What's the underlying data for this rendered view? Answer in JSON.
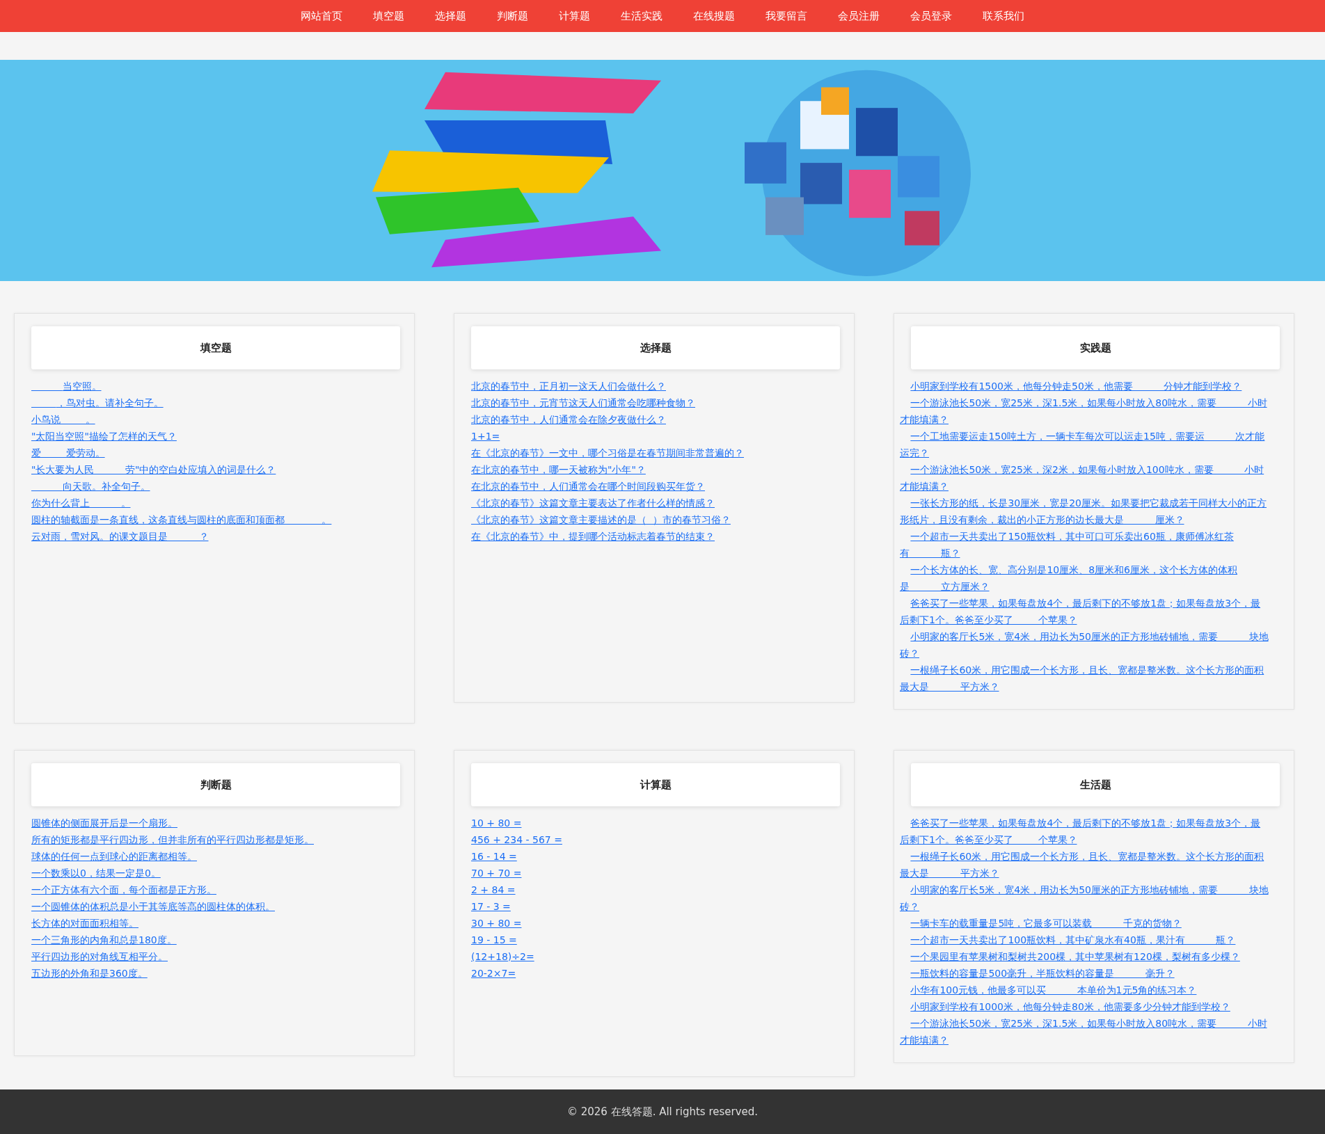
{
  "nav": [
    {
      "label": "网站首页"
    },
    {
      "label": "填空题"
    },
    {
      "label": "选择题"
    },
    {
      "label": "判断题"
    },
    {
      "label": "计算题"
    },
    {
      "label": "生活实践"
    },
    {
      "label": "在线搜题"
    },
    {
      "label": "我要留言"
    },
    {
      "label": "会员注册"
    },
    {
      "label": "会员登录"
    },
    {
      "label": "联系我们"
    }
  ],
  "cards": [
    {
      "title": "填空题",
      "indent": false,
      "items": [
        "          当空照。",
        "        ，鸟对虫。请补全句子。",
        "小鸟说        。",
        "\"太阳当空照\"描绘了怎样的天气？",
        "爱        爱劳动。",
        "\"长大要为人民          劳\"中的空白处应填入的词是什么？",
        "          向天歌。补全句子。",
        "你为什么背上          。",
        "圆柱的轴截面是一条直线，这条直线与圆柱的底面和顶面都            。",
        "云对雨，雪对风。的课文题目是          ？"
      ]
    },
    {
      "title": "选择题",
      "indent": false,
      "items": [
        "北京的春节中，正月初一这天人们会做什么？",
        "北京的春节中，元宵节这天人们通常会吃哪种食物？",
        "北京的春节中，人们通常会在除夕夜做什么？",
        "1+1=",
        "在《北京的春节》一文中，哪个习俗是在春节期间非常普遍的？",
        "在北京的春节中，哪一天被称为\"小年\"？",
        "在北京的春节中，人们通常会在哪个时间段购买年货？",
        "《北京的春节》这篇文章主要表达了作者什么样的情感？",
        "《北京的春节》这篇文章主要描述的是（  ）市的春节习俗？",
        "在《北京的春节》中，提到哪个活动标志着春节的结束？"
      ]
    },
    {
      "title": "实践题",
      "indent": true,
      "items": [
        "小明家到学校有1500米，他每分钟走50米，他需要          分钟才能到学校？",
        "一个游泳池长50米，宽25米，深1.5米，如果每小时放入80吨水，需要          小时才能填满？",
        "一个工地需要运走150吨土方，一辆卡车每次可以运走15吨，需要运          次才能运完？",
        "一个游泳池长50米，宽25米，深2米，如果每小时放入100吨水，需要          小时才能填满？",
        "一张长方形的纸，长是30厘米，宽是20厘米。如果要把它裁成若干同样大小的正方形纸片，且没有剩余，裁出的小正方形的边长最大是          厘米？",
        "一个超市一天共卖出了150瓶饮料，其中可口可乐卖出60瓶，康师傅冰红茶有          瓶？",
        "一个长方体的长、宽、高分别是10厘米、8厘米和6厘米，这个长方体的体积是          立方厘米？",
        "爸爸买了一些苹果，如果每盘放4个，最后剩下的不够放1盘；如果每盘放3个，最后剩下1个。爸爸至少买了        个苹果？",
        "小明家的客厅长5米，宽4米，用边长为50厘米的正方形地砖铺地，需要          块地砖？",
        "一根绳子长60米，用它围成一个长方形，且长、宽都是整米数。这个长方形的面积最大是          平方米？"
      ]
    },
    {
      "title": "判断题",
      "indent": false,
      "items": [
        "圆锥体的侧面展开后是一个扇形。",
        "所有的矩形都是平行四边形，但并非所有的平行四边形都是矩形。",
        "球体的任何一点到球心的距离都相等。",
        "一个数乘以0，结果一定是0。",
        "一个正方体有六个面，每个面都是正方形。",
        "一个圆锥体的体积总是小于其等底等高的圆柱体的体积。",
        "长方体的对面面积相等。",
        "一个三角形的内角和总是180度。",
        "平行四边形的对角线互相平分。",
        "五边形的外角和是360度。"
      ]
    },
    {
      "title": "计算题",
      "indent": false,
      "items": [
        "10 + 80 =",
        "456 + 234 - 567 =",
        "16 - 14 =",
        "70 + 70 =",
        "2 + 84 =",
        "17 - 3 =",
        "30 + 80 =",
        "19 - 15 =",
        "(12+18)÷2=",
        "20-2×7="
      ]
    },
    {
      "title": "生活题",
      "indent": true,
      "items": [
        "爸爸买了一些苹果，如果每盘放4个，最后剩下的不够放1盘；如果每盘放3个，最后剩下1个。爸爸至少买了        个苹果？",
        "一根绳子长60米，用它围成一个长方形，且长、宽都是整米数。这个长方形的面积最大是          平方米？",
        "小明家的客厅长5米，宽4米，用边长为50厘米的正方形地砖铺地，需要          块地砖？",
        "一辆卡车的载重量是5吨，它最多可以装载          千克的货物？",
        "一个超市一天共卖出了100瓶饮料，其中矿泉水有40瓶，果汁有          瓶？",
        "一个果园里有苹果树和梨树共200棵，其中苹果树有120棵，梨树有多少棵？",
        "一瓶饮料的容量是500毫升，半瓶饮料的容量是          毫升？",
        "小华有100元钱，他最多可以买          本单价为1元5角的练习本？",
        "小明家到学校有1000米，他每分钟走80米，他需要多少分钟才能到学校？",
        "一个游泳池长50米，宽25米，深1.5米，如果每小时放入80吨水，需要          小时才能填满？"
      ]
    }
  ],
  "footer": "© 2026 在线答题. All rights reserved."
}
